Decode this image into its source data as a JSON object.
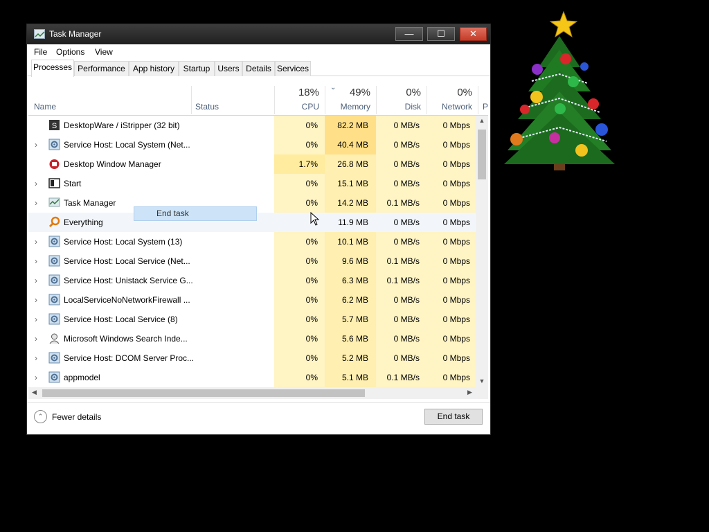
{
  "window": {
    "title": "Task Manager",
    "menu": [
      "File",
      "Options",
      "View"
    ],
    "tabs": [
      "Processes",
      "Performance",
      "App history",
      "Startup",
      "Users",
      "Details",
      "Services"
    ],
    "active_tab": "Processes"
  },
  "columns": {
    "name": "Name",
    "status": "Status",
    "cpu": {
      "pct": "18%",
      "label": "CPU"
    },
    "memory": {
      "pct": "49%",
      "label": "Memory"
    },
    "disk": {
      "pct": "0%",
      "label": "Disk"
    },
    "network": {
      "pct": "0%",
      "label": "Network"
    },
    "power_partial": "P"
  },
  "processes": [
    {
      "name": "DesktopWare / iStripper (32 bit)",
      "expandable": false,
      "icon": "istripper-icon",
      "cpu": "0%",
      "memory": "82.2 MB",
      "disk": "0 MB/s",
      "network": "0 Mbps"
    },
    {
      "name": "Service Host: Local System (Net...",
      "expandable": true,
      "icon": "gear-icon",
      "cpu": "0%",
      "memory": "40.4 MB",
      "disk": "0 MB/s",
      "network": "0 Mbps"
    },
    {
      "name": "Desktop Window Manager",
      "expandable": false,
      "icon": "dwm-icon",
      "cpu": "1.7%",
      "memory": "26.8 MB",
      "disk": "0 MB/s",
      "network": "0 Mbps"
    },
    {
      "name": "Start",
      "expandable": true,
      "icon": "start-icon",
      "cpu": "0%",
      "memory": "15.1 MB",
      "disk": "0 MB/s",
      "network": "0 Mbps"
    },
    {
      "name": "Task Manager",
      "expandable": true,
      "icon": "task-manager-icon",
      "cpu": "0%",
      "memory": "14.2 MB",
      "disk": "0.1 MB/s",
      "network": "0 Mbps"
    },
    {
      "name": "Everything",
      "expandable": false,
      "icon": "search-icon",
      "cpu": "",
      "memory": "11.9 MB",
      "disk": "0 MB/s",
      "network": "0 Mbps"
    },
    {
      "name": "Service Host: Local System (13)",
      "expandable": true,
      "icon": "gear-icon",
      "cpu": "0%",
      "memory": "10.1 MB",
      "disk": "0 MB/s",
      "network": "0 Mbps"
    },
    {
      "name": "Service Host: Local Service (Net...",
      "expandable": true,
      "icon": "gear-icon",
      "cpu": "0%",
      "memory": "9.6 MB",
      "disk": "0.1 MB/s",
      "network": "0 Mbps"
    },
    {
      "name": "Service Host: Unistack Service G...",
      "expandable": true,
      "icon": "gear-icon",
      "cpu": "0%",
      "memory": "6.3 MB",
      "disk": "0.1 MB/s",
      "network": "0 Mbps"
    },
    {
      "name": "LocalServiceNoNetworkFirewall ...",
      "expandable": true,
      "icon": "gear-icon",
      "cpu": "0%",
      "memory": "6.2 MB",
      "disk": "0 MB/s",
      "network": "0 Mbps"
    },
    {
      "name": "Service Host: Local Service (8)",
      "expandable": true,
      "icon": "gear-icon",
      "cpu": "0%",
      "memory": "5.7 MB",
      "disk": "0 MB/s",
      "network": "0 Mbps"
    },
    {
      "name": "Microsoft Windows Search Inde...",
      "expandable": true,
      "icon": "user-search-icon",
      "cpu": "0%",
      "memory": "5.6 MB",
      "disk": "0 MB/s",
      "network": "0 Mbps"
    },
    {
      "name": "Service Host: DCOM Server Proc...",
      "expandable": true,
      "icon": "gear-icon",
      "cpu": "0%",
      "memory": "5.2 MB",
      "disk": "0 MB/s",
      "network": "0 Mbps"
    },
    {
      "name": "appmodel",
      "expandable": true,
      "icon": "gear-icon",
      "cpu": "0%",
      "memory": "5.1 MB",
      "disk": "0.1 MB/s",
      "network": "0 Mbps"
    }
  ],
  "context_float": "End task",
  "footer": {
    "fewer_details": "Fewer details",
    "end_task": "End task"
  },
  "colors": {
    "cpu_light": "#fff4c4",
    "cpu_mid": "#ffec9e",
    "mem_light": "#ffefb0",
    "mem_strong": "#ffe089",
    "disk_light": "#fff4c4",
    "net_light": "#fff4c4",
    "close_red": "#c33c28",
    "highlight": "#cde3f7"
  }
}
